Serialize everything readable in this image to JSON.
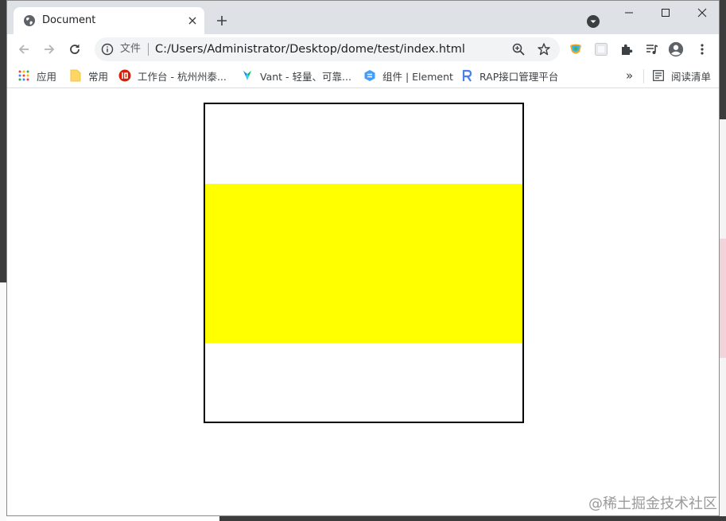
{
  "tab": {
    "title": "Document",
    "favicon_icon": "globe-icon",
    "close_icon": "close-icon"
  },
  "window_controls": {
    "minimize_icon": "minimize-icon",
    "maximize_icon": "maximize-icon",
    "close_icon": "close-icon"
  },
  "toolbar": {
    "back_icon": "back-arrow-icon",
    "forward_icon": "forward-arrow-icon",
    "reload_icon": "reload-icon"
  },
  "omnibox": {
    "security_label": "文件",
    "url": "C:/Users/Administrator/Desktop/dome/test/index.html"
  },
  "bookmarks": {
    "items": [
      {
        "label": "应用",
        "icon": "apps-grid-icon"
      },
      {
        "label": "常用",
        "icon": "folder-icon"
      },
      {
        "label": "工作台 - 杭州州泰...",
        "icon": "site-logo-icon"
      },
      {
        "label": "Vant - 轻量、可靠...",
        "icon": "vant-logo-icon"
      },
      {
        "label": "组件 | Element",
        "icon": "element-logo-icon"
      },
      {
        "label": "RAP接口管理平台",
        "icon": "rap-logo-icon"
      }
    ],
    "more": "»",
    "reading_list": "阅读清单"
  },
  "watermark": "@稀土掘金技术社区",
  "colors": {
    "inner_box": "#ffff00",
    "outer_border": "#000000",
    "titlebar": "#dee1e6"
  }
}
